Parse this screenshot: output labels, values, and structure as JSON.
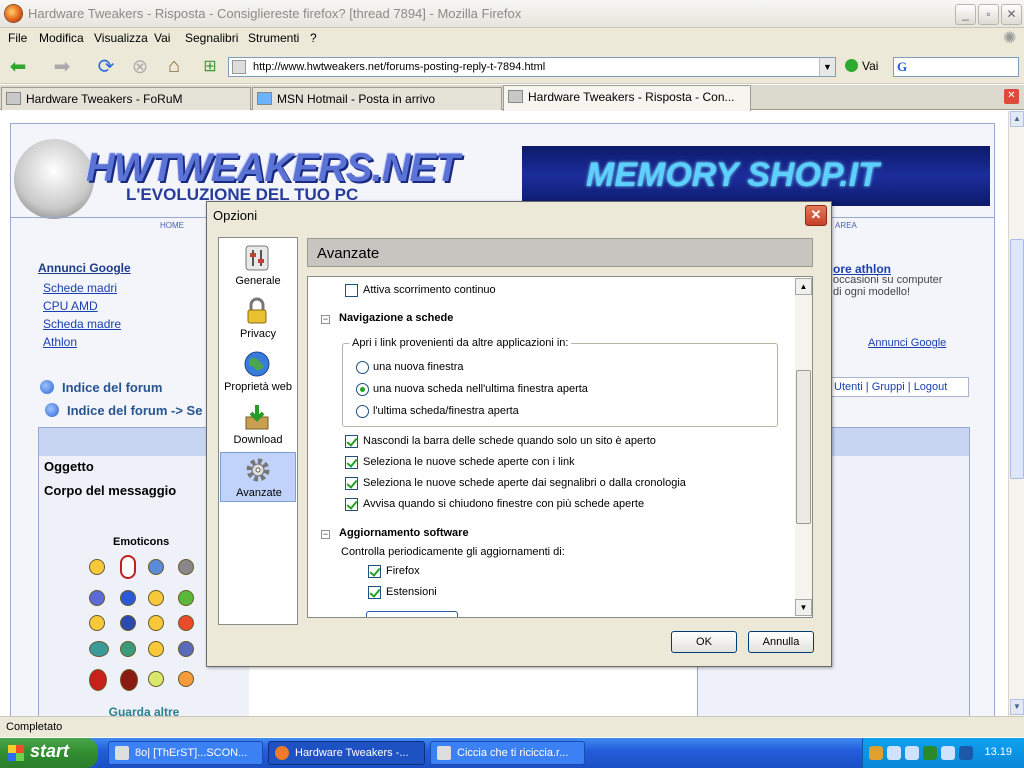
{
  "window": {
    "title": "Hardware Tweakers - Risposta - Consigliereste firefox? [thread 7894] - Mozilla Firefox",
    "min": "_",
    "max": "▫",
    "close": "✕"
  },
  "menu": [
    "File",
    "Modifica",
    "Visualizza",
    "Vai",
    "Segnalibri",
    "Strumenti",
    "?"
  ],
  "navigation": {
    "url": "http://www.hwtweakers.net/forums-posting-reply-t-7894.html",
    "go_label": "Vai",
    "search_engine": "G"
  },
  "tabs": [
    {
      "label": "Hardware Tweakers - FoRuM"
    },
    {
      "label": "MSN Hotmail - Posta in arrivo"
    },
    {
      "label": "Hardware Tweakers - Risposta - Con..."
    }
  ],
  "forum": {
    "logo": "HWTWEAKERS.NET",
    "logo_sub": "L'EVOLUZIONE DEL TUO PC",
    "banner": "MEMORY SHOP.IT",
    "nav_home": "HOME",
    "nav_area": "AREA",
    "ads_title": "Annunci Google",
    "ad_links": [
      "Schede madri",
      "CPU AMD",
      "Scheda madre",
      "Athlon"
    ],
    "index_1": "Indice del forum",
    "index_2": "Indice del forum -> Se",
    "right_ad_title": "ore athlon",
    "right_ad_text": "occasioni su computer di ogni modello!",
    "right_ads_label": "Annunci Google",
    "user_links": "Utenti | Gruppi | Logout",
    "subject_label": "Oggetto",
    "body_label": "Corpo del messaggio",
    "emoticons_title": "Emoticons",
    "more_emoticons": "Guarda altre Emoticons"
  },
  "dialog": {
    "title": "Opzioni",
    "close": "✕",
    "categories": [
      {
        "label": "Generale",
        "icon": "switches-icon"
      },
      {
        "label": "Privacy",
        "icon": "lock-icon"
      },
      {
        "label": "Proprietà web",
        "icon": "globe-icon"
      },
      {
        "label": "Download",
        "icon": "download-box-icon"
      },
      {
        "label": "Avanzate",
        "icon": "gear-icon",
        "selected": true
      }
    ],
    "pane_title": "Avanzate",
    "scroll_continuous": {
      "label": "Attiva scorrimento continuo",
      "checked": false
    },
    "tabs_section": "Navigazione a schede",
    "open_links_legend": "Apri i link provenienti da altre applicazioni in:",
    "radios": [
      {
        "label": "una nuova finestra",
        "checked": false
      },
      {
        "label": "una nuova scheda nell'ultima finestra aperta",
        "checked": true
      },
      {
        "label": "l'ultima scheda/finestra aperta",
        "checked": false
      }
    ],
    "tab_checks": [
      {
        "label": "Nascondi la barra delle schede quando solo un sito è aperto",
        "checked": true
      },
      {
        "label": "Seleziona le nuove schede aperte con i link",
        "checked": true
      },
      {
        "label": "Seleziona le nuove schede aperte dai segnalibri o dalla cronologia",
        "checked": true
      },
      {
        "label": "Avvisa quando si chiudono finestre con più schede aperte",
        "checked": true
      }
    ],
    "update_section": "Aggiornamento software",
    "update_desc": "Controlla periodicamente gli aggiornamenti di:",
    "update_checks": [
      {
        "label": "Firefox",
        "checked": true
      },
      {
        "label": "Estensioni",
        "checked": true
      }
    ],
    "ok": "OK",
    "cancel": "Annulla"
  },
  "status": "Completato",
  "taskbar": {
    "start": "start",
    "tasks": [
      {
        "label": "8o| [ThErST]...SCON..."
      },
      {
        "label": "Hardware Tweakers -..."
      },
      {
        "label": "Ciccia che ti riciccia.r..."
      }
    ],
    "clock": "13.19"
  }
}
